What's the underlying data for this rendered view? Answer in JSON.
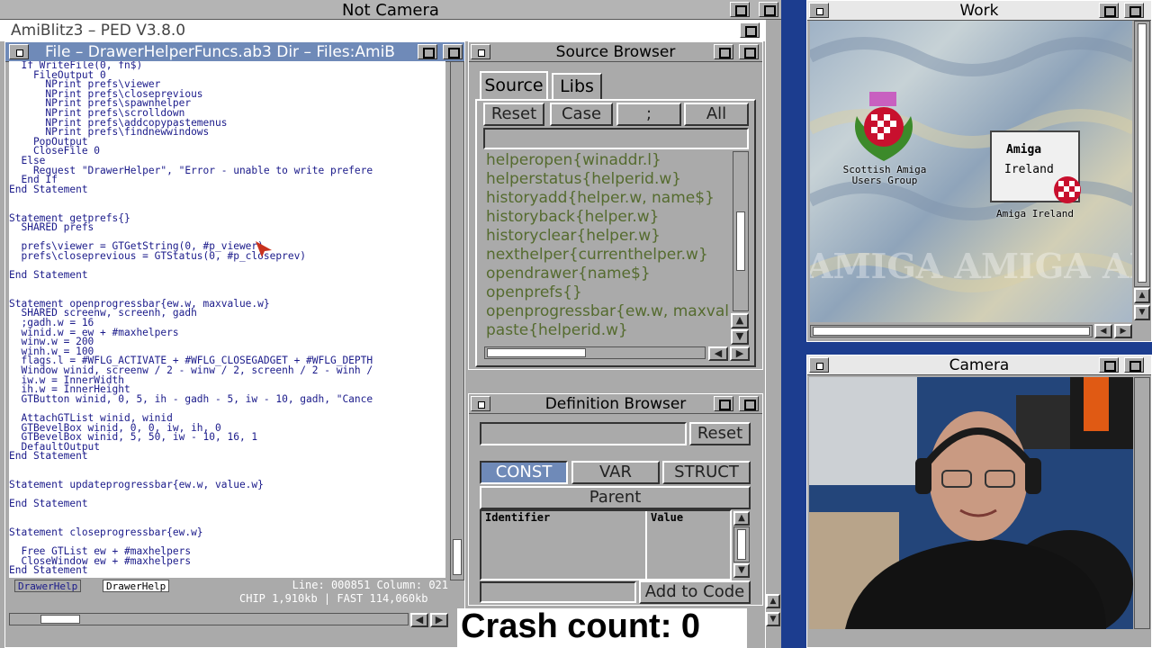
{
  "screen": {
    "title": "Not Camera"
  },
  "ped": {
    "title": "AmiBlitz3 – PED V3.8.0",
    "file_title": "File – DrawerHelperFuncs.ab3  Dir – Files:AmiB",
    "code_lines": [
      "  If WriteFile(0, fn$)",
      "    FileOutput 0",
      "      NPrint prefs\\viewer",
      "      NPrint prefs\\closeprevious",
      "      NPrint prefs\\spawnhelper",
      "      NPrint prefs\\scrolldown",
      "      NPrint prefs\\addcopypastemenus",
      "      NPrint prefs\\findnewwindows",
      "    PopOutput",
      "    CloseFile 0",
      "  Else",
      "    Request \"DrawerHelper\", \"Error - unable to write prefere",
      "  End If",
      "End Statement",
      "",
      "",
      "Statement getprefs{}",
      "  SHARED prefs",
      "",
      "  prefs\\viewer = GTGetString(0, #p_viewer)",
      "  prefs\\closeprevious = GTStatus(0, #p_closeprev)",
      "",
      "End Statement",
      "",
      "",
      "Statement openprogressbar{ew.w, maxvalue.w}",
      "  SHARED screenw, screenh, gadh",
      "  ;gadh.w = 16",
      "  winid.w = ew + #maxhelpers",
      "  winw.w = 200",
      "  winh.w = 100",
      "  flags.l = #WFLG_ACTIVATE + #WFLG_CLOSEGADGET + #WFLG_DEPTH",
      "  Window winid, screenw / 2 - winw / 2, screenh / 2 - winh /",
      "  iw.w = InnerWidth",
      "  ih.w = InnerHeight",
      "  GTButton winid, 0, 5, ih - gadh - 5, iw - 10, gadh, \"Cance",
      "",
      "  AttachGTList winid, winid",
      "  GTBevelBox winid, 0, 0, iw, ih, 0",
      "  GTBevelBox winid, 5, 50, iw - 10, 16, 1",
      "  DefaultOutput",
      "End Statement",
      "",
      "",
      "Statement updateprogressbar{ew.w, value.w}",
      "",
      "End Statement",
      "",
      "",
      "Statement closeprogressbar{ew.w}",
      "",
      "  Free GTList ew + #maxhelpers",
      "  CloseWindow ew + #maxhelpers",
      "End Statement"
    ],
    "tabs": [
      "DrawerHelp",
      "DrawerHelp"
    ],
    "status_line": "Line: 000851 Column: 021",
    "status_mem": "CHIP 1,910kb | FAST 114,060kb"
  },
  "source_browser": {
    "title": "Source Browser",
    "tabs": [
      "Source",
      "Libs"
    ],
    "buttons": [
      "Reset",
      "Case",
      ";",
      "All"
    ],
    "items": [
      "helperopen{winaddr.l}",
      "helperstatus{helperid.w}",
      "historyadd{helper.w, name$}",
      "historyback{helper.w}",
      "historyclear{helper.w}",
      "nexthelper{currenthelper.w}",
      "opendrawer{name$}",
      "openprefs{}",
      "openprogressbar{ew.w, maxvalu",
      "paste{helperid.w}"
    ]
  },
  "definition_browser": {
    "title": "Definition Browser",
    "reset": "Reset",
    "tabs": [
      "CONST",
      "VAR",
      "STRUCT"
    ],
    "parent": "Parent",
    "col_identifier": "Identifier",
    "col_value": "Value",
    "add_to_code": "Add to Code"
  },
  "work": {
    "title": "Work",
    "icons": [
      {
        "label": "Scottish Amiga Users Group"
      },
      {
        "label": "Amiga Ireland",
        "card_title": "Amiga",
        "card_sub": "Ireland"
      }
    ],
    "watermark": "AMIGA AMIGA AMIGA"
  },
  "camera": {
    "title": "Camera"
  },
  "overlay": {
    "crash_count": "Crash count: 0"
  },
  "colors": {
    "accent": "#6f8ab8",
    "workbench_grey": "#aaaaaa",
    "code_text": "#1a1a8a",
    "list_text": "#556b2f"
  }
}
